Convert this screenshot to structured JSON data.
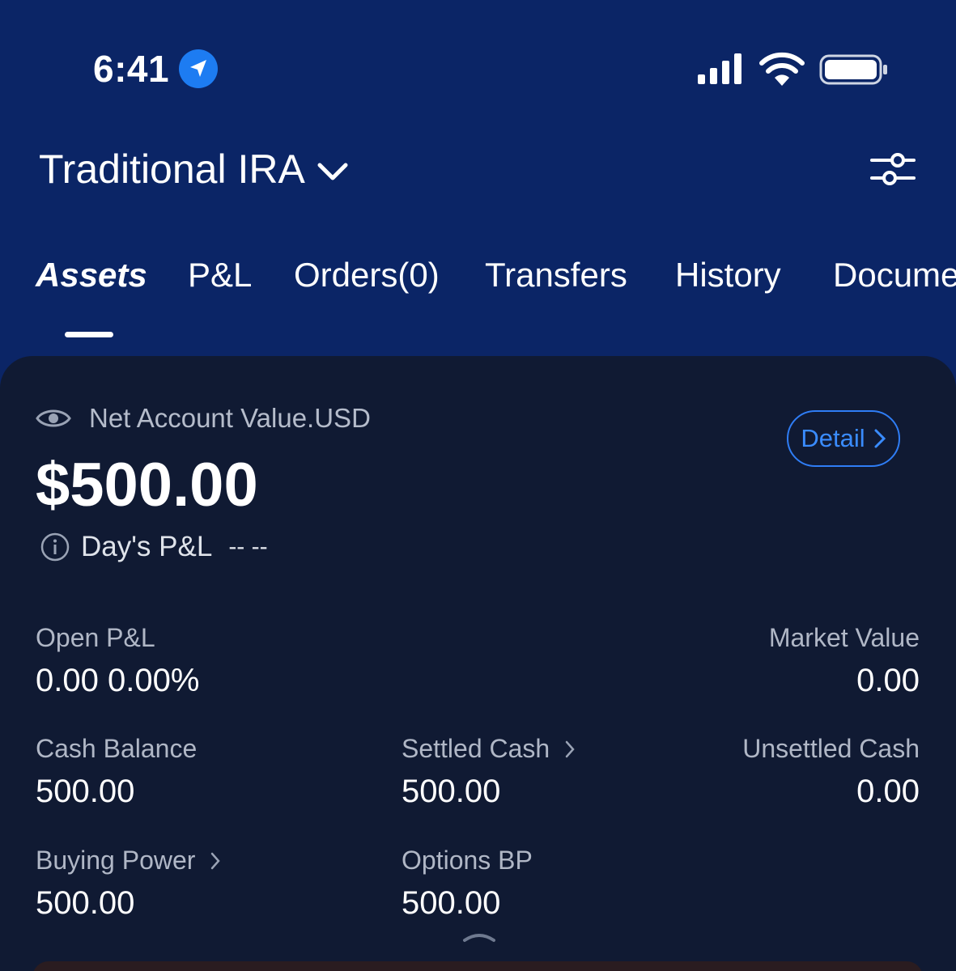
{
  "status_bar": {
    "time": "6:41"
  },
  "header": {
    "account_name": "Traditional IRA"
  },
  "tabs": [
    {
      "label": "Assets",
      "active": true
    },
    {
      "label": "P&L",
      "active": false
    },
    {
      "label": "Orders(0)",
      "active": false
    },
    {
      "label": "Transfers",
      "active": false
    },
    {
      "label": "History",
      "active": false
    },
    {
      "label": "Documents",
      "active": false
    }
  ],
  "summary": {
    "net_label": "Net Account Value.USD",
    "net_value": "$500.00",
    "detail_label": "Detail",
    "days_pnl_label": "Day's P&L",
    "days_pnl_value": "-- --"
  },
  "metrics": {
    "open_pnl": {
      "label": "Open P&L",
      "value": "0.00 0.00%"
    },
    "market_value": {
      "label": "Market Value",
      "value": "0.00"
    },
    "cash_balance": {
      "label": "Cash Balance",
      "value": "500.00"
    },
    "settled_cash": {
      "label": "Settled Cash",
      "value": "500.00"
    },
    "unsettled_cash": {
      "label": "Unsettled Cash",
      "value": "0.00"
    },
    "buying_power": {
      "label": "Buying Power",
      "value": "500.00"
    },
    "options_bp": {
      "label": "Options BP",
      "value": "500.00"
    }
  },
  "colors": {
    "header_bg": "#0b2566",
    "card_bg": "#101a33",
    "accent": "#2f7df5"
  }
}
